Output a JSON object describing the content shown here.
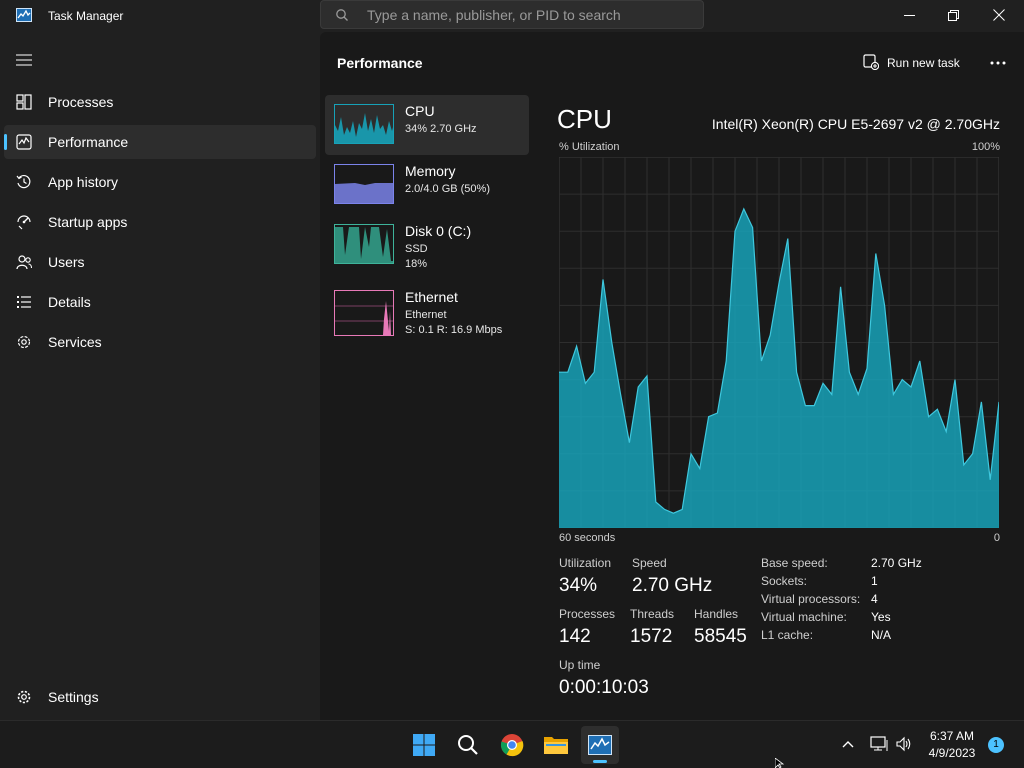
{
  "app": {
    "title": "Task Manager"
  },
  "search": {
    "placeholder": "Type a name, publisher, or PID to search"
  },
  "sidebar": {
    "items": [
      {
        "label": "Processes",
        "icon": "processes-icon"
      },
      {
        "label": "Performance",
        "icon": "performance-icon",
        "active": true
      },
      {
        "label": "App history",
        "icon": "history-icon"
      },
      {
        "label": "Startup apps",
        "icon": "startup-icon"
      },
      {
        "label": "Users",
        "icon": "users-icon"
      },
      {
        "label": "Details",
        "icon": "details-icon"
      },
      {
        "label": "Services",
        "icon": "services-icon"
      }
    ],
    "settings_label": "Settings"
  },
  "header": {
    "title": "Performance",
    "run_task_label": "Run new task"
  },
  "devices": [
    {
      "name": "CPU",
      "line1": "34%  2.70 GHz",
      "color": "#17a2b8"
    },
    {
      "name": "Memory",
      "line1": "2.0/4.0 GB (50%)",
      "color": "#7b83eb"
    },
    {
      "name": "Disk 0 (C:)",
      "line1": "SSD",
      "line2": "18%",
      "color": "#3eb39a"
    },
    {
      "name": "Ethernet",
      "line1": "Ethernet",
      "line2": "S: 0.1  R: 16.9 Mbps",
      "color": "#e879b8"
    }
  ],
  "detail": {
    "title": "CPU",
    "model": "Intel(R) Xeon(R) CPU E5-2697 v2 @ 2.70GHz",
    "util_label": "% Utilization",
    "util_max": "100%",
    "x_left": "60 seconds",
    "x_right": "0",
    "stats": {
      "utilization_label": "Utilization",
      "utilization": "34%",
      "speed_label": "Speed",
      "speed": "2.70 GHz",
      "processes_label": "Processes",
      "processes": "142",
      "threads_label": "Threads",
      "threads": "1572",
      "handles_label": "Handles",
      "handles": "58545",
      "uptime_label": "Up time",
      "uptime": "0:00:10:03"
    },
    "specs": [
      {
        "key": "Base speed:",
        "value": "2.70 GHz"
      },
      {
        "key": "Sockets:",
        "value": "1"
      },
      {
        "key": "Virtual processors:",
        "value": "4"
      },
      {
        "key": "Virtual machine:",
        "value": "Yes"
      },
      {
        "key": "L1 cache:",
        "value": "N/A"
      }
    ]
  },
  "chart_data": {
    "type": "area",
    "xlim": [
      60,
      0
    ],
    "ylim": [
      0,
      100
    ],
    "grid": true,
    "color": "#17a2b8",
    "x": [
      60,
      59,
      58,
      57,
      56,
      55,
      54,
      53,
      52,
      51,
      50,
      49,
      48,
      47,
      46,
      45,
      44,
      43,
      42,
      41,
      40,
      39,
      38,
      37,
      36,
      35,
      34,
      33,
      32,
      31,
      30,
      29,
      28,
      27,
      26,
      25,
      24,
      23,
      22,
      21,
      20,
      19,
      18,
      17,
      16,
      15,
      14,
      13,
      12,
      11,
      10,
      9,
      8,
      7,
      6,
      5,
      4,
      3,
      2,
      1,
      0
    ],
    "values": [
      42,
      42,
      49,
      39,
      42,
      67,
      50,
      36,
      23,
      38,
      41,
      7,
      5,
      4,
      5,
      20,
      16,
      30,
      31,
      45,
      80,
      86,
      81,
      45,
      52,
      66,
      78,
      42,
      33,
      33,
      39,
      36,
      65,
      42,
      36,
      43,
      74,
      60,
      36,
      40,
      38,
      45,
      30,
      32,
      26,
      40,
      17,
      20,
      34,
      13,
      34
    ]
  },
  "taskbar": {
    "apps": [
      "windows-start-icon",
      "search-icon",
      "chrome-icon",
      "file-explorer-icon",
      "task-manager-icon"
    ],
    "time": "6:37 AM",
    "date": "4/9/2023",
    "notification_count": "1"
  }
}
